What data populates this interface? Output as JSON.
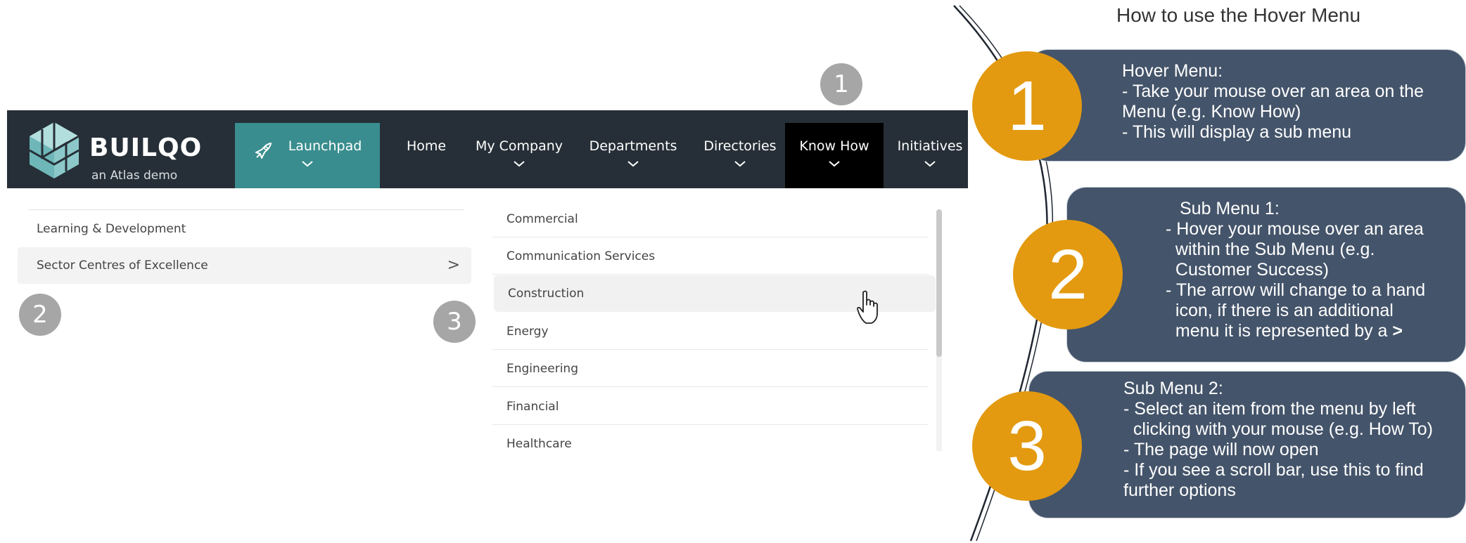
{
  "brand": {
    "name": "BUILQO",
    "tagline": "an Atlas demo",
    "logo_color": "#8cc8c9"
  },
  "nav": {
    "items": [
      {
        "label": "Launchpad",
        "icon": "rocket-icon"
      },
      {
        "label": "Home"
      },
      {
        "label": "My Company"
      },
      {
        "label": "Departments"
      },
      {
        "label": "Directories"
      },
      {
        "label": "Know How"
      },
      {
        "label": "Initiatives"
      }
    ],
    "active": "Know How",
    "colors": {
      "bar": "#262f37",
      "launchpad": "#3a8d8e",
      "active": "#000000"
    }
  },
  "submenu1": {
    "items": [
      {
        "label": "Learning & Development"
      },
      {
        "label": "Sector Centres of Excellence",
        "arrow": ">"
      }
    ]
  },
  "submenu2": {
    "items": [
      {
        "label": "Commercial"
      },
      {
        "label": "Communication Services"
      },
      {
        "label": "Construction"
      },
      {
        "label": "Energy"
      },
      {
        "label": "Engineering"
      },
      {
        "label": "Financial"
      },
      {
        "label": "Healthcare"
      }
    ],
    "hovered": "Construction"
  },
  "markers": {
    "one": "1",
    "two": "2",
    "three": "3"
  },
  "instructions": {
    "title": "How to use the Hover Menu",
    "card1": {
      "number": "1",
      "lines": [
        "Hover Menu:",
        "- Take your mouse over an area on the",
        "Menu (e.g. Know How)",
        "- This will display a sub menu"
      ]
    },
    "card2": {
      "number": "2",
      "lines": [
        "Sub Menu 1:",
        "- Hover your mouse over an area",
        "  within the Sub Menu (e.g.",
        "  Customer Success)",
        "- The arrow will change to a hand",
        "  icon, if there is an additional",
        "  menu it is represented by a"
      ],
      "symbol": ">"
    },
    "card3": {
      "number": "3",
      "lines": [
        "Sub Menu 2:",
        "- Select an item from the menu by left",
        "  clicking with your mouse (e.g. How To)",
        "- The page will now open",
        "- If you see a scroll bar, use this to find",
        "further options"
      ]
    },
    "colors": {
      "card": "#44546a",
      "number_circle": "#e39a10"
    }
  }
}
